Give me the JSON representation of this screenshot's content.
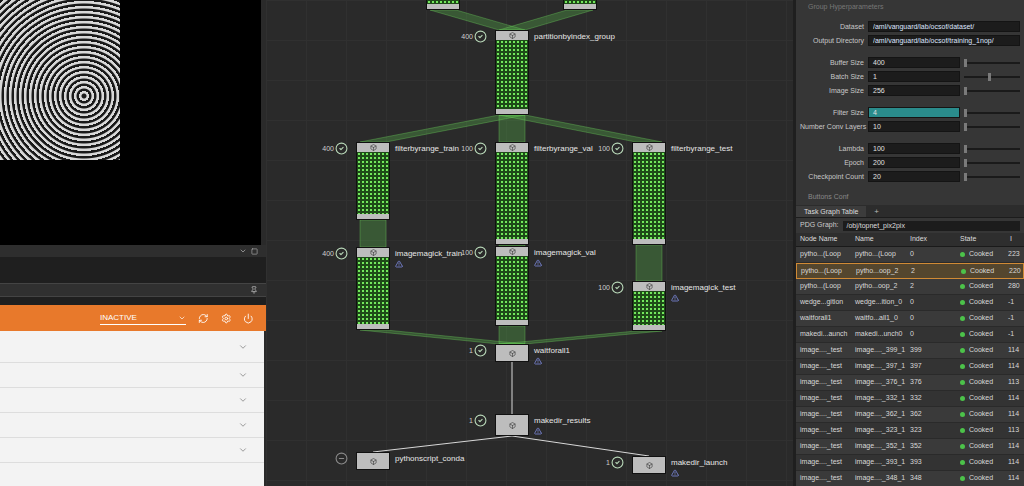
{
  "left_panel": {
    "dropdown": {
      "value": "INACTIVE"
    },
    "list_rows": [
      {
        "expanded": false
      },
      {
        "expanded": false
      },
      {
        "expanded": false
      },
      {
        "expanded": false
      },
      {
        "expanded": false
      }
    ]
  },
  "network": {
    "nodes": [
      {
        "name": "",
        "count": "",
        "status": "cooked",
        "warning": false
      },
      {
        "name": "",
        "count": "",
        "status": "cooked",
        "warning": false
      },
      {
        "name": "partitionbyindex_group",
        "count": "400",
        "status": "cooked",
        "warning": false
      },
      {
        "name": "filterbyrange_train",
        "count": "400",
        "status": "cooked",
        "warning": false
      },
      {
        "name": "filterbyrange_val",
        "count": "100",
        "status": "cooked",
        "warning": false
      },
      {
        "name": "filterbyrange_test",
        "count": "100",
        "status": "cooked",
        "warning": false
      },
      {
        "name": "imagemagick_train",
        "count": "400",
        "status": "cooked",
        "warning": true
      },
      {
        "name": "imagemagick_val",
        "count": "100",
        "status": "cooked",
        "warning": true
      },
      {
        "name": "imagemagick_test",
        "count": "100",
        "status": "cooked",
        "warning": true
      },
      {
        "name": "waitforall1",
        "count": "1",
        "status": "cooked",
        "warning": true
      },
      {
        "name": "makedir_results",
        "count": "1",
        "status": "cooked",
        "warning": true
      },
      {
        "name": "pythonscript_conda",
        "count": "",
        "status": "idle",
        "warning": false
      },
      {
        "name": "makedir_launch",
        "count": "1",
        "status": "cooked",
        "warning": true
      }
    ],
    "edges": [
      {
        "from": 0,
        "to": 2,
        "kind": "band"
      },
      {
        "from": 1,
        "to": 2,
        "kind": "band"
      },
      {
        "from": 2,
        "to": 3,
        "kind": "band"
      },
      {
        "from": 2,
        "to": 4,
        "kind": "band"
      },
      {
        "from": 2,
        "to": 5,
        "kind": "band"
      },
      {
        "from": 3,
        "to": 6,
        "kind": "band"
      },
      {
        "from": 4,
        "to": 7,
        "kind": "band"
      },
      {
        "from": 5,
        "to": 8,
        "kind": "band"
      },
      {
        "from": 6,
        "to": 9,
        "kind": "band"
      },
      {
        "from": 7,
        "to": 9,
        "kind": "band"
      },
      {
        "from": 8,
        "to": 9,
        "kind": "band"
      },
      {
        "from": 9,
        "to": 10,
        "kind": "line"
      },
      {
        "from": 10,
        "to": 11,
        "kind": "line"
      },
      {
        "from": 10,
        "to": 12,
        "kind": "line"
      }
    ]
  },
  "parameters": {
    "header": "Group Hyperparameters",
    "groups": [
      [
        {
          "label": "Dataset",
          "value": "/aml/vanguard/lab/ocsof/dataset/",
          "kind": "path",
          "level": 0,
          "highlighted": false
        },
        {
          "label": "Output Directory",
          "value": "/aml/vanguard/lab/ocsof/training_1nop/",
          "kind": "path",
          "level": 0,
          "highlighted": false
        }
      ],
      [
        {
          "label": "Buffer Size",
          "value": "400",
          "kind": "slider",
          "level": 0.0,
          "highlighted": false
        },
        {
          "label": "Batch Size",
          "value": "1",
          "kind": "slider",
          "level": 0.43,
          "highlighted": false
        },
        {
          "label": "Image Size",
          "value": "256",
          "kind": "slider",
          "level": 0.0,
          "highlighted": false
        }
      ],
      [
        {
          "label": "Filter Size",
          "value": "4",
          "kind": "slider",
          "level": 0.0,
          "highlighted": true
        },
        {
          "label": "Number Conv Layers",
          "value": "10",
          "kind": "slider",
          "level": 0.0,
          "highlighted": false
        }
      ],
      [
        {
          "label": "Lambda",
          "value": "100",
          "kind": "slider",
          "level": 0.0,
          "highlighted": false
        },
        {
          "label": "Epoch",
          "value": "200",
          "kind": "slider",
          "level": 0.0,
          "highlighted": false
        },
        {
          "label": "Checkpoint Count",
          "value": "20",
          "kind": "slider",
          "level": 0.0,
          "highlighted": false
        }
      ]
    ],
    "footer": "Buttons Conf"
  },
  "task_table": {
    "tab": {
      "label": "Task Graph Table",
      "add": "+"
    },
    "graph_label": "PDG Graph:",
    "graph_value": "/obj/topnet_pix2pix",
    "columns": [
      "Node Name",
      "Name",
      "Index",
      "State",
      "I"
    ],
    "rows": [
      {
        "node": "pytho...(Loop",
        "name": "pytho...(Loop",
        "index": "0",
        "state": "Cooked",
        "last": "223",
        "selected": false
      },
      {
        "node": "pytho...(Loop",
        "name": "pytho...oop_2",
        "index": "2",
        "state": "Cooked",
        "last": "220",
        "selected": true
      },
      {
        "node": "pytho...(Loop",
        "name": "pytho...oop_2",
        "index": "2",
        "state": "Cooked",
        "last": "280",
        "selected": false
      },
      {
        "node": "wedge...gition",
        "name": "wedge...ition_0",
        "index": "0",
        "state": "Cooked",
        "last": "-1",
        "selected": false
      },
      {
        "node": "waitforall1",
        "name": "waitfo...all1_0",
        "index": "0",
        "state": "Cooked",
        "last": "-1",
        "selected": false
      },
      {
        "node": "makedi...aunch",
        "name": "makedi...unch0",
        "index": "0",
        "state": "Cooked",
        "last": "-1",
        "selected": false
      },
      {
        "node": "image...._test",
        "name": "image...._399_1",
        "index": "399",
        "state": "Cooked",
        "last": "114",
        "selected": false
      },
      {
        "node": "image...._test",
        "name": "image...._397_1",
        "index": "397",
        "state": "Cooked",
        "last": "114",
        "selected": false
      },
      {
        "node": "image...._test",
        "name": "image...._376_1",
        "index": "376",
        "state": "Cooked",
        "last": "113",
        "selected": false
      },
      {
        "node": "image...._test",
        "name": "image...._332_1",
        "index": "332",
        "state": "Cooked",
        "last": "114",
        "selected": false
      },
      {
        "node": "image...._test",
        "name": "image...._362_1",
        "index": "362",
        "state": "Cooked",
        "last": "114",
        "selected": false
      },
      {
        "node": "image...._test",
        "name": "image...._323_1",
        "index": "323",
        "state": "Cooked",
        "last": "113",
        "selected": false
      },
      {
        "node": "image...._test",
        "name": "image...._352_1",
        "index": "352",
        "state": "Cooked",
        "last": "114",
        "selected": false
      },
      {
        "node": "image...._test",
        "name": "image...._393_1",
        "index": "393",
        "state": "Cooked",
        "last": "114",
        "selected": false
      },
      {
        "node": "image...._test",
        "name": "image...._348_1",
        "index": "348",
        "state": "Cooked",
        "last": "114",
        "selected": false
      }
    ]
  }
}
